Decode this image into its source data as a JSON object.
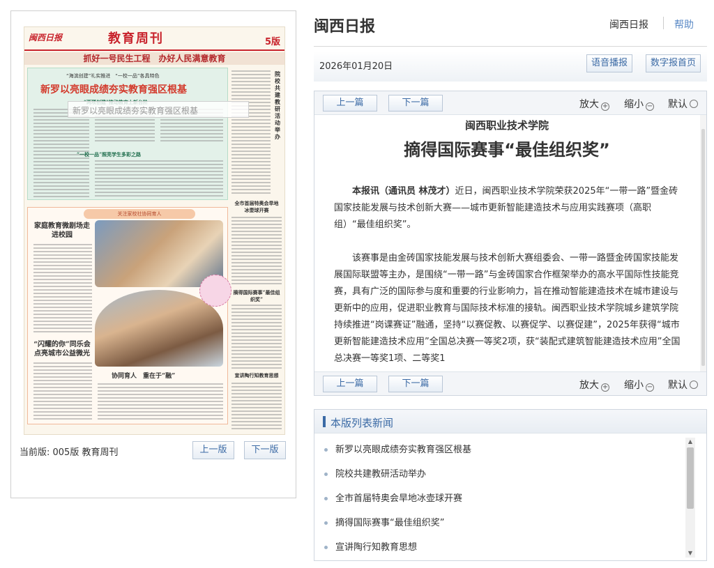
{
  "paper": {
    "masthead_logo": "闽西日报",
    "section_title": "教育周刊",
    "page_no": "5版",
    "banner": "抓好一号民生工程　办好人民满意教育",
    "headline_kicker": "“海滨创建”礼实推进　“一校一品”各具特色",
    "headline": "新罗以亮眼成绩夯实教育强区根基",
    "sub1": "“两项创建”推动教育上新台阶",
    "sub2": "“一校一品”照亮学生多彩之路",
    "hover_tooltip": "新罗以亮眼成绩夯实教育强区根基",
    "side_vertical_title": "院校共建教研活动举办",
    "side_h1": "全市首届特奥会旱地冰壶球开赛",
    "side_h2": "摘得国际赛事“最佳组织奖”",
    "side_h3": "宣讲陶行知教育思想",
    "feature_banner": "关注家校社协同育人",
    "feature_h1": "家庭教育微剧场走进校园",
    "feature_h2": "“闪耀的你”同乐会点亮城市公益微光",
    "feature_caption": "协同育人　重在于“融”"
  },
  "edition": {
    "current_label": "当前版: 005版 教育周刊",
    "prev_label": "上一版",
    "next_label": "下一版"
  },
  "header": {
    "site_title": "闽西日报",
    "link_home": "闽西日报",
    "link_help": "帮助"
  },
  "datebar": {
    "date": "2026年01月20日",
    "voice_btn": "语音播报",
    "digital_home_btn": "数字报首页"
  },
  "article_toolbar": {
    "prev": "上一篇",
    "next": "下一篇",
    "zoom_in": "放大",
    "zoom_out": "缩小",
    "default": "默认"
  },
  "article": {
    "org": "闽西职业技术学院",
    "title": "摘得国际赛事“最佳组织奖”",
    "p1_lead": "本报讯（通讯员 林茂才）",
    "p1_text": "近日，闽西职业技术学院荣获2025年“一带一路”暨金砖国家技能发展与技术创新大赛——城市更新智能建造技术与应用实践赛项（高职组）“最佳组织奖”。",
    "p2_text": "该赛事是由金砖国家技能发展与技术创新大赛组委会、一带一路暨金砖国家技能发展国际联盟等主办，是围绕“一带一路”与金砖国家合作框架举办的高水平国际性技能竞赛，具有广泛的国际参与度和重要的行业影响力，旨在推动智能建造技术在城市建设与更新中的应用，促进职业教育与国际技术标准的接轨。闽西职业技术学院城乡建筑学院持续推进“岗课赛证”融通，坚持“以赛促教、以赛促学、以赛促建”，2025年获得“城市更新智能建造技术应用”全国总决赛一等奖2项，获“装配式建筑智能建造技术应用”全国总决赛一等奖1项、二等奖1"
  },
  "news_list": {
    "heading": "本版列表新闻",
    "items": [
      "新罗以亮眼成绩夯实教育强区根基",
      "院校共建教研活动举办",
      "全市首届特奥会旱地冰壶球开赛",
      "摘得国际赛事“最佳组织奖”",
      "宣讲陶行知教育思想"
    ]
  },
  "colors": {
    "accent_blue": "#3b6aa5",
    "paper_red": "#c8232c",
    "headline_green_bg": "#e3f1e9"
  }
}
